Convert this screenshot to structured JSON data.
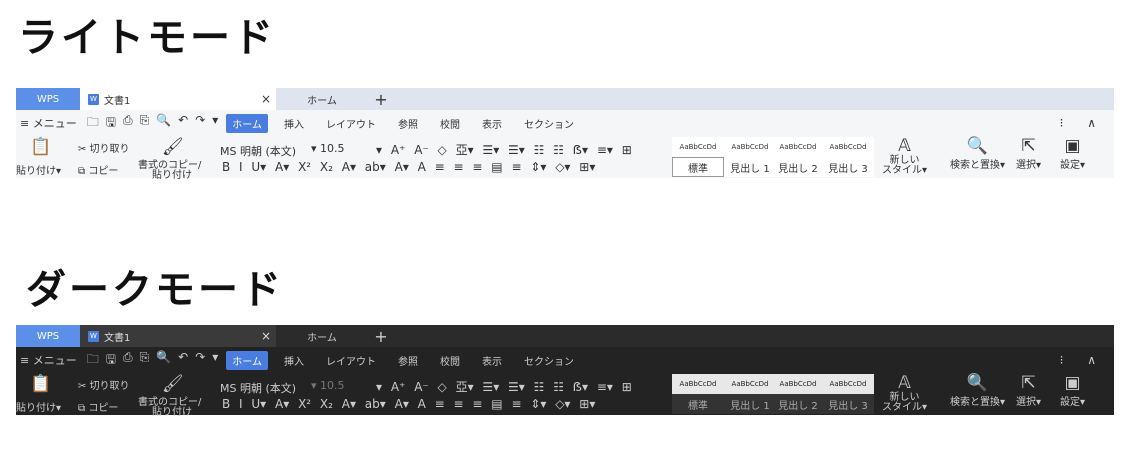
{
  "headings": {
    "light": "ライトモード",
    "dark": "ダークモード"
  },
  "tabs": {
    "wps": "WPS",
    "doc": "文書1",
    "doc_icon": "W",
    "close": "×",
    "home": "ホーム",
    "plus": "+"
  },
  "menu": {
    "hamburger": "≡ メニュー",
    "quick_icons": [
      "🗀",
      "🖫",
      "⎙",
      "⎘",
      "🔍",
      "↶",
      "↷",
      "▾"
    ],
    "tabs": [
      "ホーム",
      "挿入",
      "レイアウト",
      "参照",
      "校閲",
      "表示",
      "セクション"
    ],
    "right": "⁝ ∧"
  },
  "ribbon": {
    "paste": "貼り付け▾",
    "cut": "✂ 切り取り",
    "copy": "⧉ コピー",
    "format_copy_1": "書式のコピー/",
    "format_copy_2": "貼り付け",
    "font": "MS 明朝 (本文)",
    "size": "▾ 10.5",
    "row1_tools": "▾ A⁺ A⁻ ◇ 亞▾   ☰▾ ☰▾ ☷ ☷ ẞ▾ ≡▾ ⊞",
    "row2_tools": "B  I  U▾ A▾ X² X₂  A▾ ab▾ A▾ A   ≡ ≡ ≡ ▤ ≡ ⇕▾ ◇▾ ⊞▾",
    "styles": [
      {
        "sample": "AaBbCcDd",
        "name": "標準"
      },
      {
        "sample": "AaBbCcDd",
        "name": "見出し 1"
      },
      {
        "sample": "AaBbCcDd",
        "name": "見出し 2"
      },
      {
        "sample": "AaBbCcDd",
        "name": "見出し 3"
      }
    ],
    "new_style_1": "新しい",
    "new_style_2": "スタイル▾",
    "find_replace": "検索と置換▾",
    "select": "選択▾",
    "settings": "設定▾"
  },
  "colors": {
    "accent": "#4a7de0",
    "wps_tab": "#5b8fe8"
  }
}
